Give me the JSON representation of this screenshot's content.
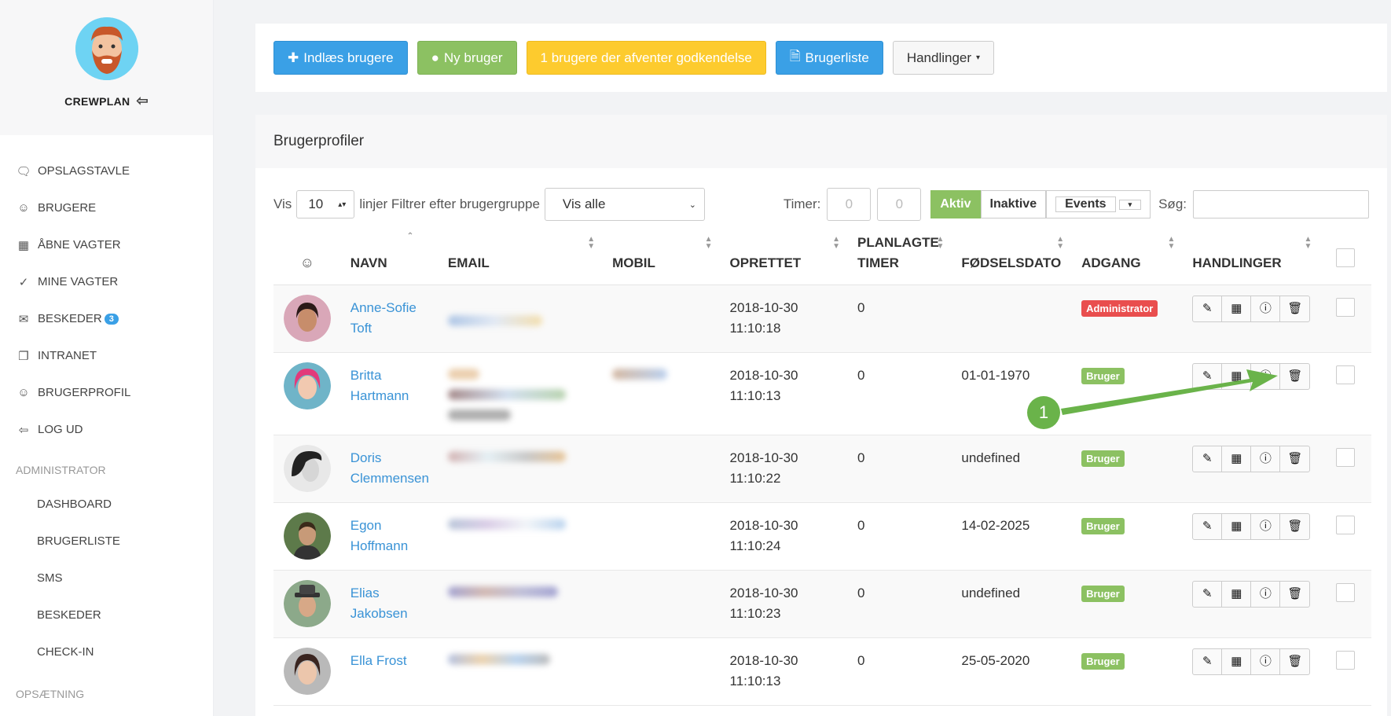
{
  "sidebar": {
    "brand": "CREWPLAN",
    "nav": [
      {
        "label": "OPSLAGSTAVLE",
        "icon": "chat-icon"
      },
      {
        "label": "BRUGERE",
        "icon": "user-icon"
      },
      {
        "label": "ÅBNE VAGTER",
        "icon": "calendar-icon"
      },
      {
        "label": "MINE VAGTER",
        "icon": "check-circle-icon"
      },
      {
        "label": "BESKEDER",
        "icon": "mail-icon",
        "badge": "3"
      },
      {
        "label": "INTRANET",
        "icon": "document-icon"
      },
      {
        "label": "BRUGERPROFIL",
        "icon": "user-icon"
      },
      {
        "label": "LOG UD",
        "icon": "logout-icon"
      }
    ],
    "admin_title": "ADMINISTRATOR",
    "admin_items": [
      "DASHBOARD",
      "BRUGERLISTE",
      "SMS",
      "BESKEDER",
      "CHECK-IN"
    ],
    "setup_title": "OPSÆTNING"
  },
  "toolbar": {
    "import_label": "Indlæs brugere",
    "new_user_label": "Ny bruger",
    "pending_label": "1 brugere der afventer godkendelse",
    "userlist_label": "Brugerliste",
    "actions_label": "Handlinger"
  },
  "panel": {
    "title": "Brugerprofiler",
    "show_label": "Vis",
    "show_value": "10",
    "lines_label": "linjer Filtrer efter brugergruppe",
    "group_value": "Vis alle",
    "timer_label": "Timer:",
    "timer_from_placeholder": "0",
    "timer_to_placeholder": "0",
    "filter_active": "Aktiv",
    "filter_inactive": "Inaktive",
    "filter_events": "Events",
    "search_label": "Søg:"
  },
  "table": {
    "headers": {
      "name": "NAVN",
      "email": "EMAIL",
      "mobile": "MOBIL",
      "created": "OPRETTET",
      "hours_1": "PLANLAGTE",
      "hours_2": "TIMER",
      "birth": "FØDSELSDATO",
      "access": "ADGANG",
      "actions": "HANDLINGER"
    },
    "rows": [
      {
        "first": "Anne-Sofie",
        "last": "Toft",
        "date": "2018-10-30",
        "time": "11:10:18",
        "hours": "0",
        "birth": "",
        "access": "Administrator"
      },
      {
        "first": "Britta",
        "last": "Hartmann",
        "date": "2018-10-30",
        "time": "11:10:13",
        "hours": "0",
        "birth": "01-01-1970",
        "access": "Bruger"
      },
      {
        "first": "Doris",
        "last": "Clemmensen",
        "date": "2018-10-30",
        "time": "11:10:22",
        "hours": "0",
        "birth": "undefined",
        "access": "Bruger"
      },
      {
        "first": "Egon",
        "last": "Hoffmann",
        "date": "2018-10-30",
        "time": "11:10:24",
        "hours": "0",
        "birth": "14-02-2025",
        "access": "Bruger"
      },
      {
        "first": "Elias",
        "last": "Jakobsen",
        "date": "2018-10-30",
        "time": "11:10:23",
        "hours": "0",
        "birth": "undefined",
        "access": "Bruger"
      },
      {
        "first": "Ella Frost",
        "last": "",
        "date": "2018-10-30",
        "time": "11:10:13",
        "hours": "0",
        "birth": "25-05-2020",
        "access": "Bruger"
      }
    ]
  },
  "annotation": {
    "number": "1"
  },
  "colors": {
    "primary": "#3aa0e6",
    "success": "#8cc162",
    "warning": "#fdcb2e",
    "danger": "#e94e4e",
    "link": "#3a93d6"
  }
}
